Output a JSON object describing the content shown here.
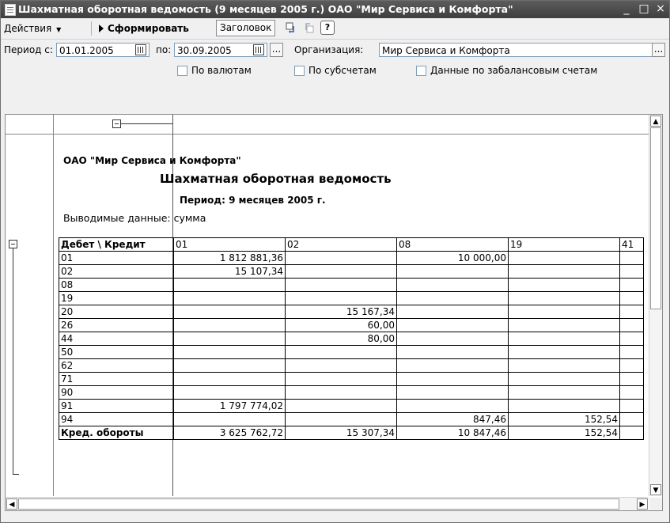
{
  "window": {
    "title": "Шахматная оборотная ведомость (9 месяцев 2005 г.) ОАО \"Мир Сервиса и Комфорта\"",
    "controls": {
      "minimize": "_",
      "maximize": "□",
      "close": "×"
    }
  },
  "toolbar": {
    "actions_label": "Действия",
    "generate_label": "Сформировать",
    "header_label": "Заголовок",
    "help_label": "?"
  },
  "params": {
    "period_from_label": "Период с:",
    "period_from_value": "01.01.2005",
    "period_to_label": "по:",
    "period_to_value": "30.09.2005",
    "ellipsis_label": "...",
    "org_label": "Организация:",
    "org_value": "Мир Сервиса и Комфорта",
    "checkbox_currency": "По валютам",
    "checkbox_subaccounts": "По субсчетам",
    "checkbox_offbalance": "Данные по забалансовым счетам"
  },
  "report": {
    "org_name": "ОАО \"Мир Сервиса и Комфорта\"",
    "title": "Шахматная оборотная ведомость",
    "period": "Период: 9 месяцев 2005 г.",
    "output_data": "Выводимые данные: сумма",
    "table": {
      "corner": "Дебет \\ Кредит",
      "columns": [
        "01",
        "02",
        "08",
        "19",
        "41"
      ],
      "rows": [
        {
          "account": "01",
          "cells": [
            "1 812 881,36",
            "",
            "10 000,00",
            "",
            ""
          ]
        },
        {
          "account": "02",
          "cells": [
            "15 107,34",
            "",
            "",
            "",
            ""
          ]
        },
        {
          "account": "08",
          "cells": [
            "",
            "",
            "",
            "",
            ""
          ]
        },
        {
          "account": "19",
          "cells": [
            "",
            "",
            "",
            "",
            ""
          ]
        },
        {
          "account": "20",
          "cells": [
            "",
            "15 167,34",
            "",
            "",
            ""
          ]
        },
        {
          "account": "26",
          "cells": [
            "",
            "60,00",
            "",
            "",
            ""
          ]
        },
        {
          "account": "44",
          "cells": [
            "",
            "80,00",
            "",
            "",
            ""
          ]
        },
        {
          "account": "50",
          "cells": [
            "",
            "",
            "",
            "",
            ""
          ]
        },
        {
          "account": "62",
          "cells": [
            "",
            "",
            "",
            "",
            ""
          ]
        },
        {
          "account": "71",
          "cells": [
            "",
            "",
            "",
            "",
            ""
          ]
        },
        {
          "account": "90",
          "cells": [
            "",
            "",
            "",
            "",
            ""
          ]
        },
        {
          "account": "91",
          "cells": [
            "1 797 774,02",
            "",
            "",
            "",
            ""
          ]
        },
        {
          "account": "94",
          "cells": [
            "",
            "",
            "847,46",
            "152,54",
            ""
          ]
        }
      ],
      "totals": {
        "label": "Кред. обороты",
        "cells": [
          "3 625 762,72",
          "15 307,34",
          "10 847,46",
          "152,54",
          ""
        ]
      }
    }
  }
}
